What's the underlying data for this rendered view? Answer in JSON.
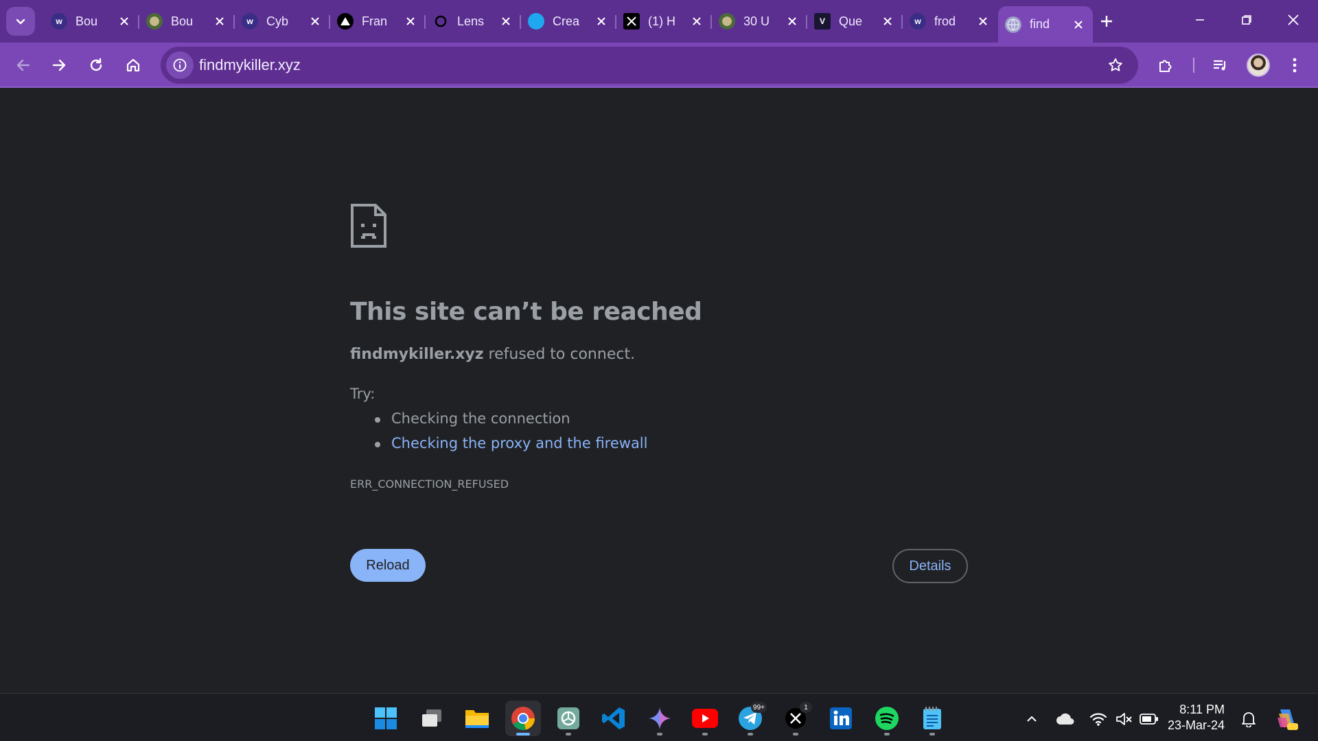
{
  "browser": {
    "tabs": [
      {
        "title": "Bou",
        "favicon": "w-icon",
        "active": false
      },
      {
        "title": "Bou",
        "favicon": "globe-photo-icon",
        "active": false
      },
      {
        "title": "Cyb",
        "favicon": "w-icon",
        "active": false
      },
      {
        "title": "Fran",
        "favicon": "triangle-icon",
        "active": false
      },
      {
        "title": "Lens",
        "favicon": "lens-icon",
        "active": false
      },
      {
        "title": "Crea",
        "favicon": "blue-drop-icon",
        "active": false
      },
      {
        "title": "(1) H",
        "favicon": "x-logo-icon",
        "active": false
      },
      {
        "title": "30 U",
        "favicon": "globe-photo-icon",
        "active": false
      },
      {
        "title": "Que",
        "favicon": "v-logo-icon",
        "active": false
      },
      {
        "title": "frod",
        "favicon": "w-icon",
        "active": false
      },
      {
        "title": "find",
        "favicon": "globe-icon",
        "active": true
      }
    ],
    "url": "findmykiller.xyz",
    "colors": {
      "frame": "#5b2f8f",
      "toolbar": "#7b46b5",
      "link": "#8ab4f8"
    }
  },
  "error_page": {
    "title": "This site can’t be reached",
    "host": "findmykiller.xyz",
    "message": " refused to connect.",
    "try_label": "Try:",
    "suggestions": [
      "Checking the connection",
      "Checking the proxy and the firewall"
    ],
    "code": "ERR_CONNECTION_REFUSED",
    "reload_label": "Reload",
    "details_label": "Details"
  },
  "taskbar": {
    "apps": [
      "windows-start-icon",
      "task-view-icon",
      "file-explorer-icon",
      "chrome-icon",
      "chatgpt-icon",
      "vscode-icon",
      "gemini-icon",
      "youtube-icon",
      "telegram-icon",
      "x-icon",
      "linkedin-icon",
      "spotify-icon",
      "notepad-icon"
    ],
    "telegram_badge": "99+",
    "x_badge": "1",
    "time": "8:11 PM",
    "date": "23-Mar-24"
  }
}
